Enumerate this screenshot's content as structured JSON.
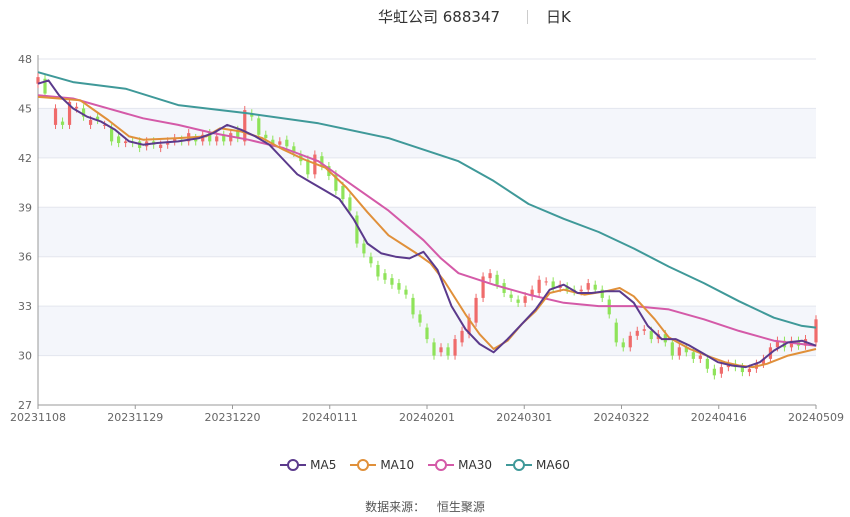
{
  "header": {
    "title": "华虹公司 688347",
    "period": "日K"
  },
  "source": {
    "label": "数据来源：",
    "provider": "恒生聚源"
  },
  "colors": {
    "up": "#ef6b6b",
    "down": "#8fe35a",
    "ma5": "#5b3a8c",
    "ma10": "#e0903a",
    "ma30": "#d45aa8",
    "ma60": "#3f9999"
  },
  "chart_data": {
    "type": "candlestick",
    "yticks": [
      27,
      30,
      33,
      36,
      39,
      42,
      45,
      48
    ],
    "ylim": [
      27,
      48
    ],
    "xticks": [
      "20231108",
      "20231129",
      "20231220",
      "20240111",
      "20240201",
      "20240301",
      "20240322",
      "20240416",
      "20240509"
    ],
    "legend": [
      "MA5",
      "MA10",
      "MA30",
      "MA60"
    ],
    "legend_position": "bottom",
    "ma60": [
      [
        0,
        47.2
      ],
      [
        10,
        46.6
      ],
      [
        25,
        46.2
      ],
      [
        40,
        45.2
      ],
      [
        60,
        44.7
      ],
      [
        80,
        44.1
      ],
      [
        100,
        43.2
      ],
      [
        120,
        41.8
      ],
      [
        130,
        40.6
      ],
      [
        140,
        39.2
      ],
      [
        150,
        38.3
      ],
      [
        160,
        37.5
      ],
      [
        170,
        36.5
      ],
      [
        180,
        35.4
      ],
      [
        190,
        34.4
      ],
      [
        200,
        33.3
      ],
      [
        210,
        32.3
      ],
      [
        218,
        31.8
      ],
      [
        222,
        31.7
      ]
    ],
    "ma30": [
      [
        0,
        45.8
      ],
      [
        10,
        45.6
      ],
      [
        20,
        45.0
      ],
      [
        30,
        44.4
      ],
      [
        40,
        44.0
      ],
      [
        50,
        43.5
      ],
      [
        60,
        43.1
      ],
      [
        70,
        42.6
      ],
      [
        80,
        41.8
      ],
      [
        90,
        40.3
      ],
      [
        100,
        38.8
      ],
      [
        110,
        37.0
      ],
      [
        115,
        35.9
      ],
      [
        120,
        35.0
      ],
      [
        130,
        34.3
      ],
      [
        140,
        33.7
      ],
      [
        150,
        33.2
      ],
      [
        160,
        33.0
      ],
      [
        170,
        33.0
      ],
      [
        180,
        32.8
      ],
      [
        190,
        32.2
      ],
      [
        200,
        31.5
      ],
      [
        210,
        30.9
      ],
      [
        222,
        30.6
      ]
    ],
    "ma10": [
      [
        0,
        45.7
      ],
      [
        6,
        45.6
      ],
      [
        12,
        45.5
      ],
      [
        20,
        44.3
      ],
      [
        26,
        43.3
      ],
      [
        30,
        43.1
      ],
      [
        40,
        43.2
      ],
      [
        48,
        43.3
      ],
      [
        52,
        43.8
      ],
      [
        58,
        43.6
      ],
      [
        64,
        43.2
      ],
      [
        70,
        42.5
      ],
      [
        76,
        41.9
      ],
      [
        82,
        41.4
      ],
      [
        88,
        40.2
      ],
      [
        94,
        38.7
      ],
      [
        100,
        37.3
      ],
      [
        108,
        36.2
      ],
      [
        112,
        35.6
      ],
      [
        116,
        34.5
      ],
      [
        122,
        32.5
      ],
      [
        126,
        31.3
      ],
      [
        130,
        30.4
      ],
      [
        134,
        30.9
      ],
      [
        138,
        31.9
      ],
      [
        142,
        32.7
      ],
      [
        146,
        33.8
      ],
      [
        150,
        34.0
      ],
      [
        156,
        33.7
      ],
      [
        162,
        33.9
      ],
      [
        166,
        34.1
      ],
      [
        170,
        33.6
      ],
      [
        176,
        32.2
      ],
      [
        180,
        31.1
      ],
      [
        186,
        30.4
      ],
      [
        192,
        29.9
      ],
      [
        196,
        29.6
      ],
      [
        200,
        29.4
      ],
      [
        204,
        29.3
      ],
      [
        208,
        29.5
      ],
      [
        214,
        30.0
      ],
      [
        222,
        30.4
      ]
    ],
    "ma5": [
      [
        0,
        46.5
      ],
      [
        3,
        46.7
      ],
      [
        6,
        45.8
      ],
      [
        10,
        45.0
      ],
      [
        14,
        44.5
      ],
      [
        18,
        44.2
      ],
      [
        22,
        43.7
      ],
      [
        26,
        43.0
      ],
      [
        30,
        42.8
      ],
      [
        34,
        42.9
      ],
      [
        40,
        43.0
      ],
      [
        46,
        43.2
      ],
      [
        50,
        43.5
      ],
      [
        54,
        44.0
      ],
      [
        58,
        43.7
      ],
      [
        62,
        43.3
      ],
      [
        66,
        42.8
      ],
      [
        70,
        41.9
      ],
      [
        74,
        41.0
      ],
      [
        78,
        40.5
      ],
      [
        82,
        40.0
      ],
      [
        86,
        39.5
      ],
      [
        90,
        38.3
      ],
      [
        94,
        36.8
      ],
      [
        98,
        36.2
      ],
      [
        102,
        36.0
      ],
      [
        106,
        35.9
      ],
      [
        110,
        36.3
      ],
      [
        114,
        35.2
      ],
      [
        118,
        33.0
      ],
      [
        122,
        31.6
      ],
      [
        126,
        30.7
      ],
      [
        130,
        30.2
      ],
      [
        134,
        31.0
      ],
      [
        138,
        31.9
      ],
      [
        142,
        32.8
      ],
      [
        146,
        34.0
      ],
      [
        150,
        34.3
      ],
      [
        154,
        33.8
      ],
      [
        158,
        33.8
      ],
      [
        162,
        33.9
      ],
      [
        166,
        33.9
      ],
      [
        170,
        33.2
      ],
      [
        174,
        31.8
      ],
      [
        178,
        31.0
      ],
      [
        182,
        31.0
      ],
      [
        186,
        30.6
      ],
      [
        190,
        30.1
      ],
      [
        194,
        29.6
      ],
      [
        198,
        29.4
      ],
      [
        202,
        29.3
      ],
      [
        206,
        29.6
      ],
      [
        210,
        30.3
      ],
      [
        214,
        30.8
      ],
      [
        218,
        30.9
      ],
      [
        222,
        30.6
      ]
    ],
    "candles": [
      [
        0,
        46.5,
        46.9
      ],
      [
        2,
        46.8,
        45.9
      ],
      [
        5,
        44.0,
        45.0
      ],
      [
        7,
        44.2,
        44.0
      ],
      [
        9,
        44.0,
        45.4
      ],
      [
        11,
        45.0,
        45.1
      ],
      [
        13,
        45.0,
        44.5
      ],
      [
        15,
        44.0,
        44.3
      ],
      [
        17,
        44.5,
        44.3
      ],
      [
        19,
        44.0,
        44.0
      ],
      [
        21,
        43.8,
        43.0
      ],
      [
        23,
        43.3,
        42.9
      ],
      [
        25,
        42.9,
        43.0
      ],
      [
        27,
        43.0,
        42.9
      ],
      [
        29,
        43.0,
        42.6
      ],
      [
        31,
        42.7,
        43.0
      ],
      [
        33,
        43.0,
        42.8
      ],
      [
        35,
        42.6,
        42.8
      ],
      [
        37,
        42.8,
        43.0
      ],
      [
        39,
        43.0,
        43.2
      ],
      [
        41,
        43.1,
        43.0
      ],
      [
        43,
        43.0,
        43.5
      ],
      [
        45,
        43.2,
        43.0
      ],
      [
        47,
        43.0,
        43.4
      ],
      [
        49,
        43.5,
        43.0
      ],
      [
        51,
        43.0,
        43.3
      ],
      [
        53,
        43.4,
        43.0
      ],
      [
        55,
        43.0,
        43.5
      ],
      [
        57,
        43.7,
        43.2
      ],
      [
        59,
        43.0,
        44.9
      ],
      [
        61,
        44.7,
        44.5
      ],
      [
        63,
        44.4,
        43.4
      ],
      [
        65,
        43.4,
        43.2
      ],
      [
        67,
        43.1,
        42.8
      ],
      [
        69,
        42.8,
        43.0
      ],
      [
        71,
        43.1,
        42.7
      ],
      [
        73,
        42.7,
        42.3
      ],
      [
        75,
        42.2,
        41.8
      ],
      [
        77,
        41.9,
        41.0
      ],
      [
        79,
        41.0,
        42.2
      ],
      [
        81,
        42.1,
        41.5
      ],
      [
        83,
        41.5,
        40.9
      ],
      [
        85,
        41.0,
        40.0
      ],
      [
        87,
        40.3,
        39.5
      ],
      [
        89,
        39.6,
        38.8
      ],
      [
        91,
        38.5,
        36.8
      ],
      [
        93,
        36.8,
        36.2
      ],
      [
        95,
        36.0,
        35.6
      ],
      [
        97,
        35.5,
        34.8
      ],
      [
        99,
        35.0,
        34.6
      ],
      [
        101,
        34.7,
        34.3
      ],
      [
        103,
        34.4,
        34.0
      ],
      [
        105,
        34.0,
        33.7
      ],
      [
        107,
        33.5,
        32.5
      ],
      [
        109,
        32.5,
        32.0
      ],
      [
        111,
        31.7,
        31.0
      ],
      [
        113,
        30.8,
        30.0
      ],
      [
        115,
        30.2,
        30.5
      ],
      [
        117,
        30.5,
        30.0
      ],
      [
        119,
        30.0,
        31.0
      ],
      [
        121,
        30.8,
        31.5
      ],
      [
        123,
        31.3,
        32.3
      ],
      [
        125,
        32.0,
        33.5
      ],
      [
        127,
        33.5,
        34.8
      ],
      [
        129,
        34.7,
        35.0
      ],
      [
        131,
        34.9,
        34.3
      ],
      [
        133,
        34.4,
        33.8
      ],
      [
        135,
        33.7,
        33.5
      ],
      [
        137,
        33.4,
        33.2
      ],
      [
        139,
        33.2,
        33.6
      ],
      [
        141,
        33.6,
        34.0
      ],
      [
        143,
        33.8,
        34.6
      ],
      [
        145,
        34.5,
        34.5
      ],
      [
        147,
        34.5,
        34.1
      ],
      [
        149,
        34.1,
        34.3
      ],
      [
        151,
        34.2,
        34.0
      ],
      [
        153,
        34.0,
        33.9
      ],
      [
        155,
        33.9,
        34.0
      ],
      [
        157,
        34.0,
        34.4
      ],
      [
        159,
        34.3,
        34.0
      ],
      [
        161,
        34.0,
        33.5
      ],
      [
        163,
        33.4,
        32.5
      ],
      [
        165,
        32.0,
        30.8
      ],
      [
        167,
        30.8,
        30.5
      ],
      [
        169,
        30.5,
        31.2
      ],
      [
        171,
        31.2,
        31.5
      ],
      [
        173,
        31.5,
        31.6
      ],
      [
        175,
        31.5,
        31.0
      ],
      [
        177,
        31.0,
        31.3
      ],
      [
        179,
        31.3,
        30.8
      ],
      [
        181,
        30.8,
        30.0
      ],
      [
        183,
        30.0,
        30.5
      ],
      [
        185,
        30.5,
        30.2
      ],
      [
        187,
        30.2,
        29.8
      ],
      [
        189,
        29.8,
        30.0
      ],
      [
        191,
        29.8,
        29.2
      ],
      [
        193,
        29.2,
        28.8
      ],
      [
        195,
        28.9,
        29.3
      ],
      [
        197,
        29.3,
        29.5
      ],
      [
        199,
        29.5,
        29.3
      ],
      [
        201,
        29.3,
        29.0
      ],
      [
        203,
        29.0,
        29.2
      ],
      [
        205,
        29.2,
        29.5
      ],
      [
        207,
        29.5,
        29.8
      ],
      [
        209,
        29.8,
        30.5
      ],
      [
        211,
        30.5,
        30.9
      ],
      [
        213,
        30.9,
        30.5
      ],
      [
        215,
        30.5,
        30.9
      ],
      [
        217,
        30.9,
        30.6
      ],
      [
        219,
        30.6,
        31.0
      ],
      [
        222,
        30.8,
        32.2
      ]
    ]
  }
}
